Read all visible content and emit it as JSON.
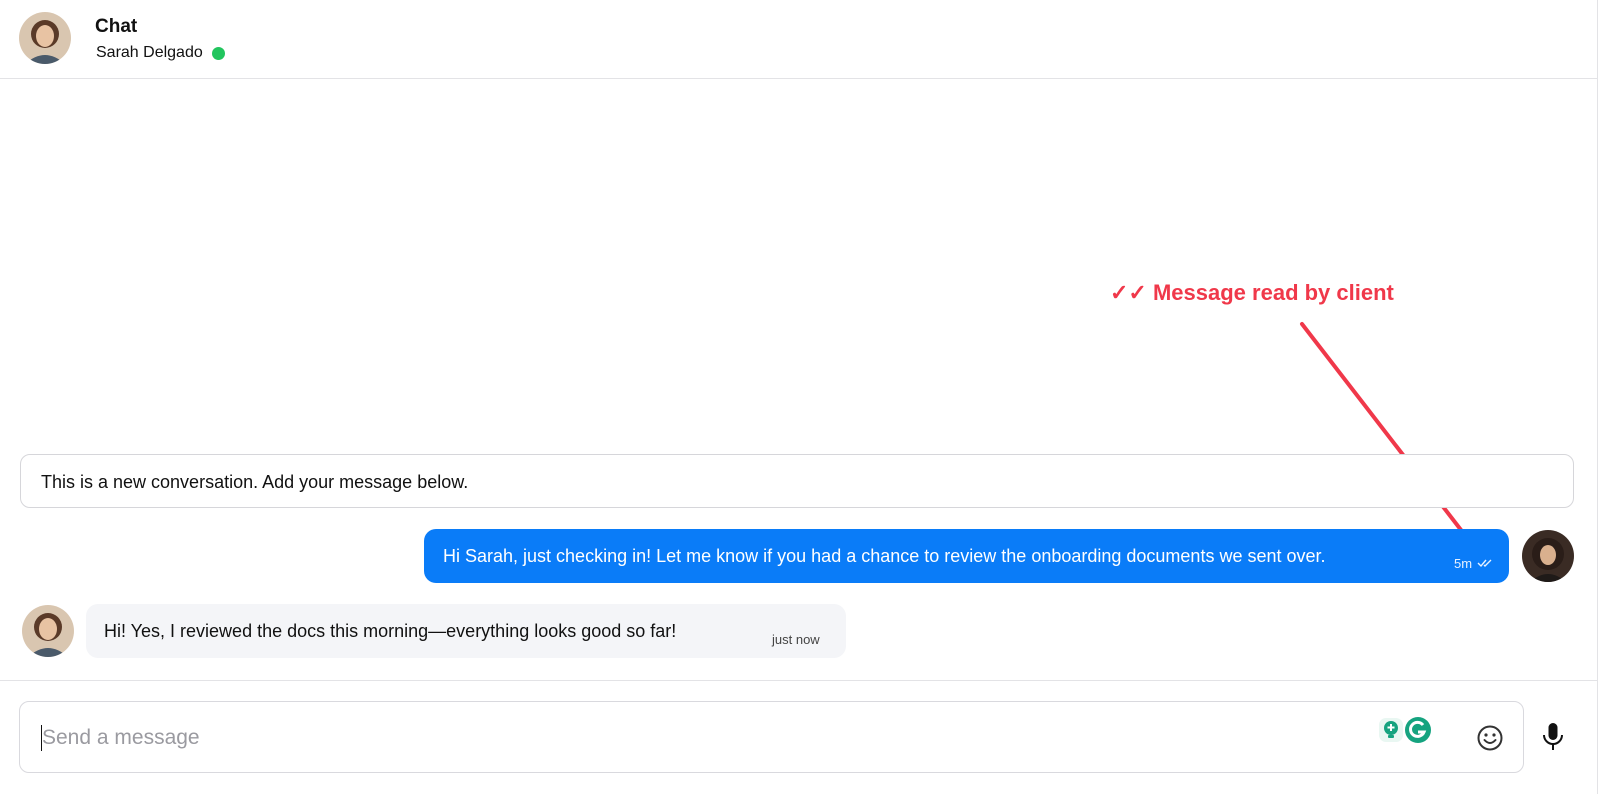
{
  "header": {
    "title": "Chat",
    "contact_name": "Sarah Delgado",
    "status_color": "#22c55e"
  },
  "annotation": {
    "text": "✓✓ Message read by client",
    "color": "#f0384a"
  },
  "conversation": {
    "notice": "This is a new conversation. Add your message below.",
    "messages": [
      {
        "direction": "outgoing",
        "text": "Hi Sarah, just checking in! Let me know if you had a chance to review the onboarding documents we sent over.",
        "time": "5m",
        "status_icon": "double-check-icon",
        "bubble_color": "#0a7cf8"
      },
      {
        "direction": "incoming",
        "text": "Hi! Yes, I reviewed the docs this morning—everything looks good so far!",
        "time": "just now",
        "bubble_color": "#f4f5f8"
      }
    ]
  },
  "composer": {
    "placeholder": "Send a message",
    "value": "",
    "icons": [
      "grammar-assistant-icon",
      "grammarly-icon",
      "emoji-icon",
      "microphone-icon"
    ]
  }
}
